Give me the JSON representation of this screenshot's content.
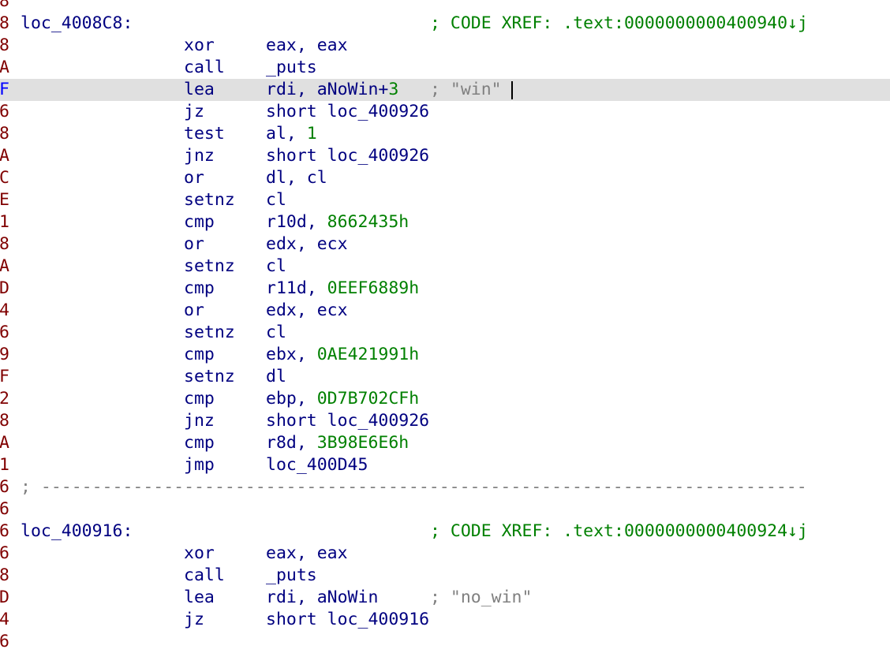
{
  "window": {
    "background": "#ffffff",
    "highlight": "#e0e0e0"
  },
  "colors": {
    "code": "#000080",
    "gutter": "#800000",
    "gutter_current": "#0000ff",
    "number": "#008000",
    "comment": "#808080",
    "xref": "#008000"
  },
  "lines": [
    {
      "gutter": "8",
      "kind": "blank"
    },
    {
      "gutter": "8",
      "kind": "label",
      "label": "loc_4008C8:",
      "xref": "; CODE XREF: .text:0000000000400940↓j"
    },
    {
      "gutter": "8",
      "kind": "insn",
      "mnemonic": "xor",
      "operand": "eax, eax"
    },
    {
      "gutter": "A",
      "kind": "insn",
      "mnemonic": "call",
      "operand": "_puts"
    },
    {
      "gutter": "F",
      "kind": "insn",
      "highlighted": true,
      "mnemonic": "lea",
      "operand": "rdi, aNoWin+",
      "operand_num": "3",
      "comment": "; \"win\""
    },
    {
      "gutter": "6",
      "kind": "insn",
      "mnemonic": "jz",
      "operand": "short loc_400926"
    },
    {
      "gutter": "8",
      "kind": "insn",
      "mnemonic": "test",
      "operand": "al, ",
      "operand_num": "1"
    },
    {
      "gutter": "A",
      "kind": "insn",
      "mnemonic": "jnz",
      "operand": "short loc_400926"
    },
    {
      "gutter": "C",
      "kind": "insn",
      "mnemonic": "or",
      "operand": "dl, cl"
    },
    {
      "gutter": "E",
      "kind": "insn",
      "mnemonic": "setnz",
      "operand": "cl"
    },
    {
      "gutter": "1",
      "kind": "insn",
      "mnemonic": "cmp",
      "operand": "r10d, ",
      "operand_num": "8662435h"
    },
    {
      "gutter": "8",
      "kind": "insn",
      "mnemonic": "or",
      "operand": "edx, ecx"
    },
    {
      "gutter": "A",
      "kind": "insn",
      "mnemonic": "setnz",
      "operand": "cl"
    },
    {
      "gutter": "D",
      "kind": "insn",
      "mnemonic": "cmp",
      "operand": "r11d, ",
      "operand_num": "0EEF6889h"
    },
    {
      "gutter": "4",
      "kind": "insn",
      "mnemonic": "or",
      "operand": "edx, ecx"
    },
    {
      "gutter": "6",
      "kind": "insn",
      "mnemonic": "setnz",
      "operand": "cl"
    },
    {
      "gutter": "9",
      "kind": "insn",
      "mnemonic": "cmp",
      "operand": "ebx, ",
      "operand_num": "0AE421991h"
    },
    {
      "gutter": "F",
      "kind": "insn",
      "mnemonic": "setnz",
      "operand": "dl"
    },
    {
      "gutter": "2",
      "kind": "insn",
      "mnemonic": "cmp",
      "operand": "ebp, ",
      "operand_num": "0D7B702CFh"
    },
    {
      "gutter": "8",
      "kind": "insn",
      "mnemonic": "jnz",
      "operand": "short loc_400926"
    },
    {
      "gutter": "A",
      "kind": "insn",
      "mnemonic": "cmp",
      "operand": "r8d, ",
      "operand_num": "3B98E6E6h"
    },
    {
      "gutter": "1",
      "kind": "insn",
      "mnemonic": "jmp",
      "operand": "loc_400D45"
    },
    {
      "gutter": "6",
      "kind": "sep",
      "text": "; ---------------------------------------------------------------------------"
    },
    {
      "gutter": "6",
      "kind": "blank"
    },
    {
      "gutter": "6",
      "kind": "label",
      "label": "loc_400916:",
      "xref": "; CODE XREF: .text:0000000000400924↓j"
    },
    {
      "gutter": "6",
      "kind": "insn",
      "mnemonic": "xor",
      "operand": "eax, eax"
    },
    {
      "gutter": "8",
      "kind": "insn",
      "mnemonic": "call",
      "operand": "_puts"
    },
    {
      "gutter": "D",
      "kind": "insn",
      "mnemonic": "lea",
      "operand": "rdi, aNoWin",
      "comment": "; \"no_win\""
    },
    {
      "gutter": "4",
      "kind": "insn",
      "mnemonic": "jz",
      "operand": "short loc_400916"
    },
    {
      "gutter": "6",
      "kind": "blank"
    }
  ]
}
